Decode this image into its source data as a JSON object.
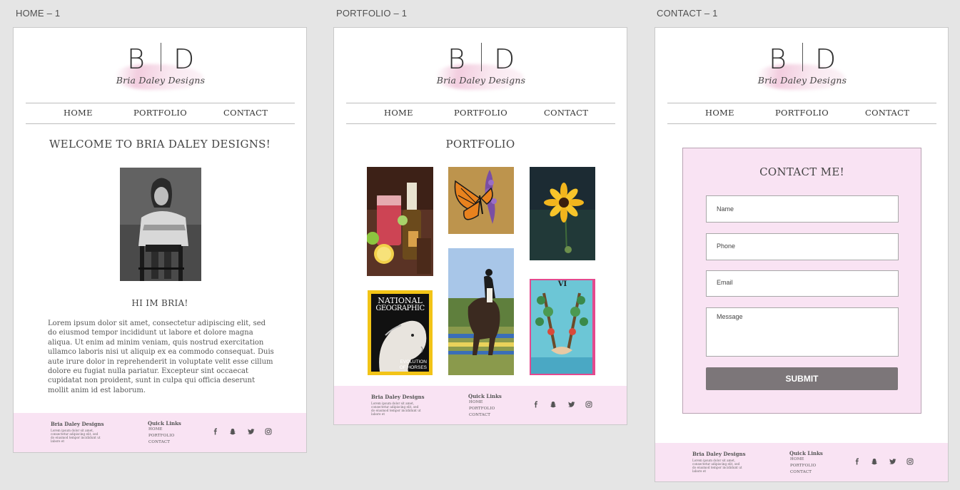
{
  "artboards": {
    "home": "HOME – 1",
    "portfolio": "PORTFOLIO – 1",
    "contact": "CONTACT – 1"
  },
  "logo": {
    "left_letter": "B",
    "right_letter": "D",
    "script": "Bria Daley Designs"
  },
  "nav": {
    "home": "HOME",
    "portfolio": "PORTFOLIO",
    "contact": "CONTACT"
  },
  "home": {
    "title": "WELCOME TO BRIA DALEY DESIGNS!",
    "subtitle": "HI IM BRIA!",
    "body": "Lorem ipsum dolor sit amet, consectetur adipiscing elit, sed do eiusmod tempor incididunt ut labore et dolore magna aliqua. Ut enim ad minim veniam, quis nostrud exercitation ullamco laboris nisi ut aliquip ex ea commodo consequat. Duis aute irure dolor in reprehenderit in voluptate velit esse cillum dolore eu fugiat nulla pariatur. Excepteur sint occaecat cupidatat non proident, sunt in culpa qui officia deserunt mollit anim id est laborum."
  },
  "portfolio": {
    "title": "PORTFOLIO",
    "magazine": {
      "masthead_line1": "NATIONAL",
      "masthead_line2": "GEOGRAPHIC",
      "cover_line1": "EVOLUTION",
      "cover_line2": "OF HORSES"
    },
    "tarot_numeral": "VI"
  },
  "contact": {
    "title": "CONTACT ME!",
    "fields": {
      "name": "Name",
      "phone": "Phone",
      "email": "Email",
      "message": "Message"
    },
    "submit": "SUBMIT"
  },
  "footer": {
    "brand": "Bria Daley Designs",
    "text": "Lorem ipsum dolor sit amet, consectetur adipiscing elit, sed do eiusmod tempor incididunt ut labore et",
    "quick_links": "Quick Links",
    "links": [
      "HOME",
      "PORTFOLIO",
      "CONTACT"
    ],
    "social_icons": [
      "facebook-icon",
      "snapchat-icon",
      "twitter-icon",
      "instagram-icon"
    ]
  },
  "colors": {
    "canvas": "#e5e5e5",
    "footer_pink": "#f9e3f3",
    "form_pink": "#f9e3f3",
    "submit_gray": "#7c7679"
  }
}
